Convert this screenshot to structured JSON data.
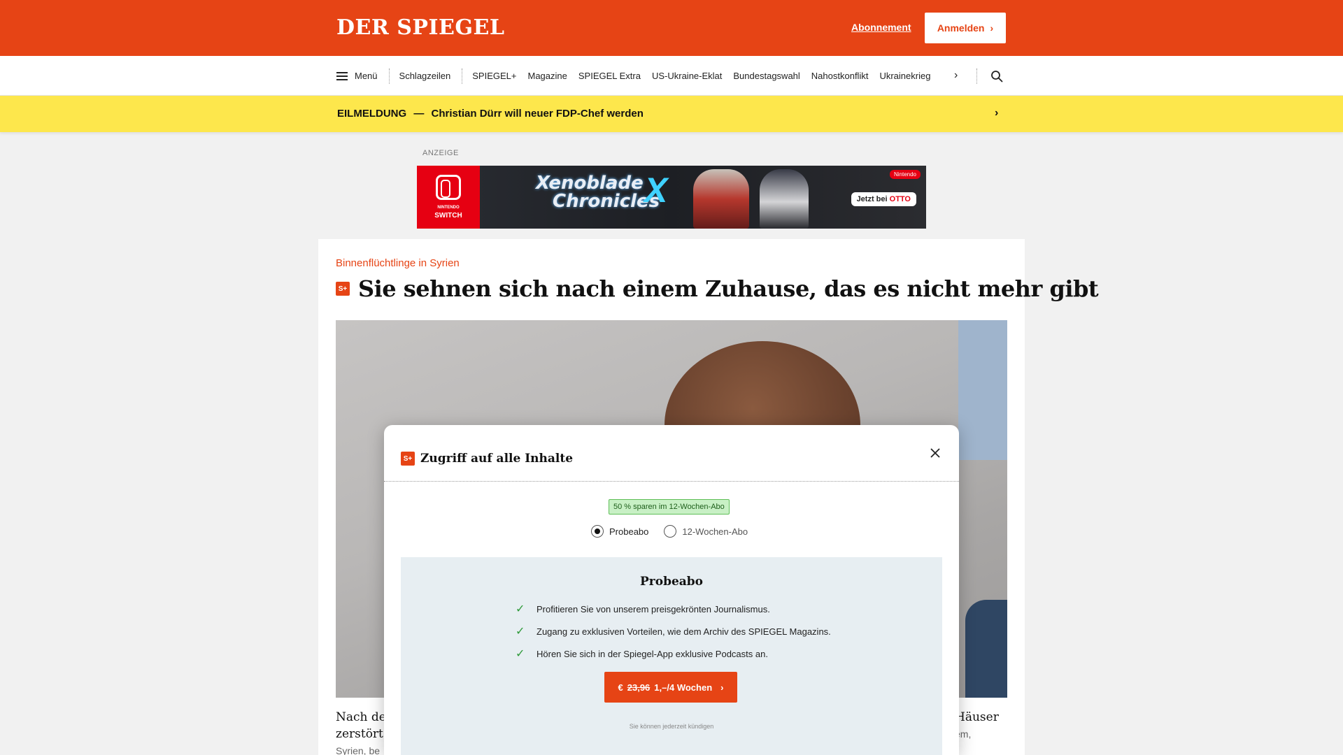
{
  "header": {
    "logo": "DER SPIEGEL",
    "subscription_link": "Abonnement",
    "login_button": "Anmelden",
    "login_chevron": "›"
  },
  "nav": {
    "menu_label": "Menü",
    "items": [
      "Schlagzeilen",
      "SPIEGEL+",
      "Magazine",
      "SPIEGEL Extra",
      "US-Ukraine-Eklat",
      "Bundestagswahl",
      "Nahostkonflikt",
      "Ukrainekrieg"
    ],
    "more_chevron": "›"
  },
  "breaking": {
    "label": "EILMELDUNG",
    "dash": "—",
    "text": "Christian Dürr will neuer FDP-Chef werden",
    "chevron": "›"
  },
  "ad": {
    "label": "ANZEIGE",
    "platform_small": "NINTENDO",
    "platform": "SWITCH",
    "game_line1": "Xenoblade",
    "game_line2": "Chronicles",
    "game_mark": "X",
    "brand_tag": "Nintendo",
    "cta_prefix": "Jetzt bei",
    "cta_shop": "OTTO"
  },
  "article": {
    "kicker": "Binnenflüchtlinge in Syrien",
    "splus_badge": "S+",
    "headline": "Sie sehnen sich nach einem Zuhause, das es nicht mehr gibt",
    "teaser_left_l1": "Nach der",
    "teaser_left_l2": "zerstört e",
    "teaser_left_l3": "Syrien, be",
    "teaser_right_l1": "Häuser",
    "teaser_right_l2": "em,"
  },
  "modal": {
    "badge": "S+",
    "title": "Zugriff auf alle Inhalte",
    "save_badge": "50 % sparen im 12-Wochen-Abo",
    "options": [
      {
        "label": "Probeabo",
        "checked": true
      },
      {
        "label": "12-Wochen-Abo",
        "checked": false
      }
    ],
    "plan": {
      "title": "Probeabo",
      "benefits": [
        "Profitieren Sie von unserem preisgekrönten Journalismus.",
        "Zugang zu exklusiven Vorteilen, wie dem Archiv des SPIEGEL Magazins.",
        "Hören Sie sich in der Spiegel-App exklusive Podcasts an."
      ],
      "cta_currency": "€",
      "cta_old_price": "23,96",
      "cta_new_price": "1,–/4 Wochen",
      "cta_chevron": "›",
      "cancel_note": "Sie können jederzeit kündigen"
    }
  },
  "colors": {
    "brand": "#e64415",
    "breaking": "#fde74c",
    "plan_bg": "#e7eef2",
    "save_badge_bg": "#c8f0c5"
  }
}
